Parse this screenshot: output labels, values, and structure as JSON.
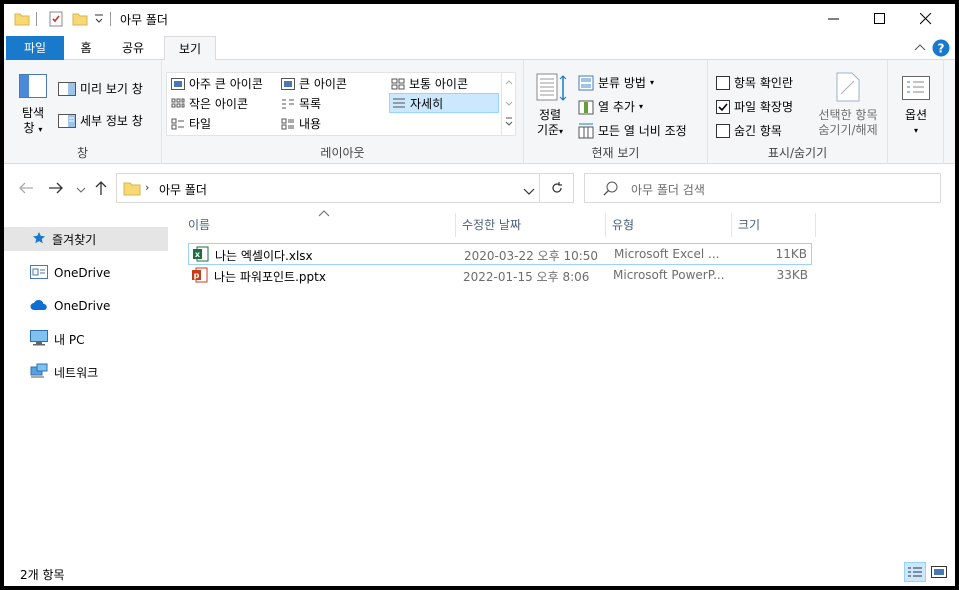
{
  "window": {
    "title": "아무 폴더"
  },
  "ribbon_tabs": {
    "file": "파일",
    "home": "홈",
    "share": "공유",
    "view": "보기"
  },
  "ribbon": {
    "pane": {
      "nav_pane_line1": "탐색",
      "nav_pane_line2": "창",
      "preview": "미리 보기 창",
      "details": "세부 정보 창",
      "label": "창"
    },
    "layout": {
      "extra_large": "아주 큰 아이콘",
      "large": "큰 아이콘",
      "medium": "보통 아이콘",
      "small": "작은 아이콘",
      "list": "목록",
      "details": "자세히",
      "tiles": "타일",
      "content": "내용",
      "label": "레이아웃"
    },
    "current_view": {
      "sort_line1": "정렬",
      "sort_line2": "기준",
      "group_by": "분류 방법",
      "add_columns": "열 추가",
      "size_all_columns": "모든 열 너비 조정",
      "label": "현재 보기"
    },
    "show_hide": {
      "item_checkboxes": "항목 확인란",
      "item_checkboxes_checked": false,
      "file_extensions": "파일 확장명",
      "file_extensions_checked": true,
      "hidden_items": "숨긴 항목",
      "hidden_items_checked": false,
      "hide_selected_line1": "선택한 항목",
      "hide_selected_line2": "숨기기/해제",
      "label": "표시/숨기기"
    },
    "options": "옵션"
  },
  "address": {
    "path": "아무 폴더",
    "search_placeholder": "아무 폴더 검색"
  },
  "sidebar": {
    "items": [
      {
        "label": "즐겨찾기",
        "icon": "star-icon"
      },
      {
        "label": "OneDrive",
        "icon": "onedrive-folder-icon"
      },
      {
        "label": "OneDrive",
        "icon": "cloud-icon"
      },
      {
        "label": "내 PC",
        "icon": "pc-icon"
      },
      {
        "label": "네트워크",
        "icon": "network-icon"
      }
    ]
  },
  "columns": {
    "name": "이름",
    "modified": "수정한 날짜",
    "type": "유형",
    "size": "크기"
  },
  "files": [
    {
      "name": "나는 엑셀이다.xlsx",
      "modified": "2020-03-22 오후 10:50",
      "type": "Microsoft Excel ...",
      "size": "11KB",
      "icon": "excel-file-icon"
    },
    {
      "name": "나는 파워포인트.pptx",
      "modified": "2022-01-15 오후 8:06",
      "type": "Microsoft PowerP...",
      "size": "33KB",
      "icon": "powerpoint-file-icon"
    }
  ],
  "status": {
    "item_count": "2개 항목"
  },
  "colors": {
    "accent": "#1979ca",
    "selection": "#cce8ff",
    "folder": "#f8d775",
    "excel": "#1d6f42",
    "powerpoint": "#c43e1c"
  }
}
